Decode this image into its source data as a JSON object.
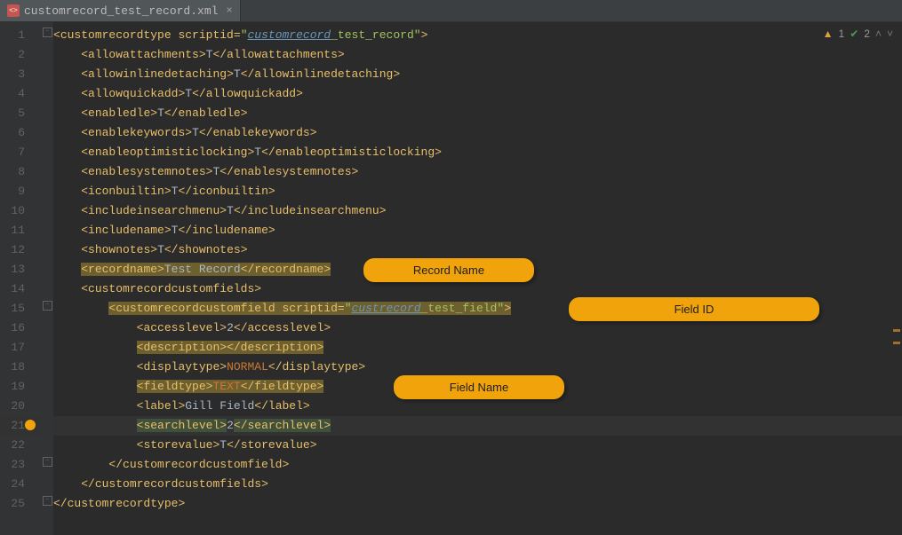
{
  "tab": {
    "filename": "customrecord_test_record.xml"
  },
  "status": {
    "warn": "1",
    "ok": "2"
  },
  "callouts": {
    "record_name": "Record Name",
    "field_id": "Field ID",
    "field_name": "Field Name"
  },
  "code": {
    "root_tag": "customrecordtype",
    "root_attr": "scriptid",
    "root_val_link": "customrecord",
    "root_val_rest": "_test_record",
    "l2": {
      "tag": "allowattachments",
      "val": "T"
    },
    "l3": {
      "tag": "allowinlinedetaching",
      "val": "T"
    },
    "l4": {
      "tag": "allowquickadd",
      "val": "T"
    },
    "l5": {
      "tag": "enabledle",
      "val": "T"
    },
    "l6": {
      "tag": "enablekeywords",
      "val": "T"
    },
    "l7": {
      "tag": "enableoptimisticlocking",
      "val": "T"
    },
    "l8": {
      "tag": "enablesystemnotes",
      "val": "T"
    },
    "l9": {
      "tag": "iconbuiltin",
      "val": "T"
    },
    "l10": {
      "tag": "includeinsearchmenu",
      "val": "T"
    },
    "l11": {
      "tag": "includename",
      "val": "T"
    },
    "l12": {
      "tag": "shownotes",
      "val": "T"
    },
    "l13": {
      "tag": "recordname",
      "val": "Test Record"
    },
    "l14": {
      "tag": "customrecordcustomfields"
    },
    "l15": {
      "tag": "customrecordcustomfield",
      "attr": "scriptid",
      "val_link": "custrecord",
      "val_rest": "_test_field"
    },
    "l16": {
      "tag": "accesslevel",
      "val": "2"
    },
    "l17": {
      "tag": "description"
    },
    "l18": {
      "tag": "displaytype",
      "val": "NORMAL"
    },
    "l19": {
      "tag": "fieldtype",
      "val": "TEXT"
    },
    "l20": {
      "tag": "label",
      "val": "Gill Field"
    },
    "l21": {
      "tag": "searchlevel",
      "val": "2"
    },
    "l22": {
      "tag": "storevalue",
      "val": "T"
    }
  },
  "lines": [
    "1",
    "2",
    "3",
    "4",
    "5",
    "6",
    "7",
    "8",
    "9",
    "10",
    "11",
    "12",
    "13",
    "14",
    "15",
    "16",
    "17",
    "18",
    "19",
    "20",
    "21",
    "22",
    "23",
    "24",
    "25"
  ]
}
